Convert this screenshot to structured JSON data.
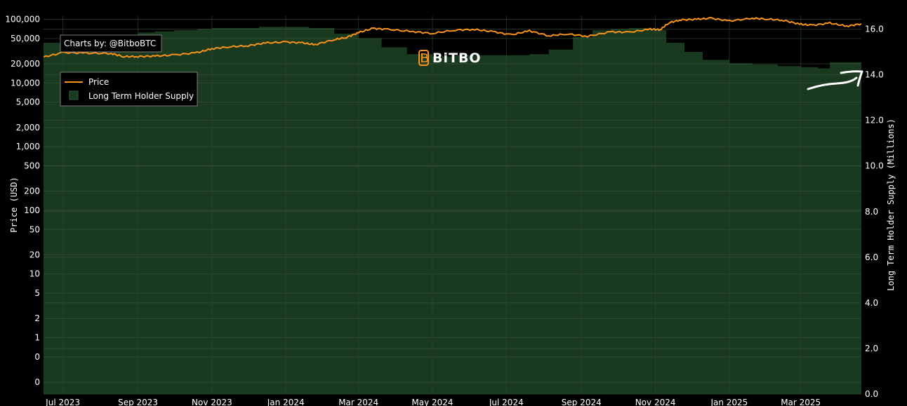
{
  "chart_data": {
    "type": "area",
    "credit": "Charts by: @BitboBTC",
    "logo": "BiTBO",
    "x_tick_labels": [
      "Jul 2023",
      "Sep 2023",
      "Nov 2023",
      "Jan 2024",
      "Mar 2024",
      "May 2024",
      "Jul 2024",
      "Sep 2024",
      "Nov 2024",
      "Jan 2025",
      "Mar 2025"
    ],
    "x_tick_dates": [
      "2023-07-01",
      "2023-09-01",
      "2023-11-01",
      "2024-01-01",
      "2024-03-01",
      "2024-05-01",
      "2024-07-01",
      "2024-09-01",
      "2024-11-01",
      "2025-01-01",
      "2025-03-01"
    ],
    "x_range": [
      "2023-06-15",
      "2025-04-20"
    ],
    "y_left": {
      "title": "Price (USD)",
      "scale": "log",
      "tick_labels": [
        "100,000",
        "50,000",
        "20,000",
        "10,000",
        "5,000",
        "2,000",
        "1,000",
        "500",
        "200",
        "100",
        "50",
        "20",
        "10",
        "5",
        "2",
        "1",
        "0",
        "0"
      ],
      "tick_values": [
        100000,
        50000,
        20000,
        10000,
        5000,
        2000,
        1000,
        500,
        200,
        100,
        50,
        20,
        10,
        5,
        2,
        1,
        0.5,
        0.2
      ],
      "range": [
        0.13,
        115000
      ]
    },
    "y_right": {
      "title": "Long Term Holder Supply (Millions)",
      "scale": "linear",
      "tick_labels": [
        "16.0",
        "14.0",
        "12.0",
        "10.0",
        "8.0",
        "6.0",
        "4.0",
        "2.0",
        "0.0"
      ],
      "tick_values": [
        16,
        14,
        12,
        10,
        8,
        6,
        4,
        2,
        0
      ],
      "range": [
        0,
        16.6
      ]
    },
    "grid": true,
    "legend": {
      "placement": "top-left",
      "items": [
        {
          "label": "Price",
          "color": "#f7931a"
        },
        {
          "label": "Long Term Holder Supply",
          "color": "#1a3a1f"
        }
      ]
    },
    "series": [
      {
        "name": "Price",
        "color": "#f7931a",
        "axis": "left",
        "x": [
          "2023-06-15",
          "2023-07-01",
          "2023-07-20",
          "2023-08-10",
          "2023-08-20",
          "2023-09-01",
          "2023-09-15",
          "2023-10-01",
          "2023-10-20",
          "2023-11-01",
          "2023-11-15",
          "2023-12-01",
          "2023-12-15",
          "2024-01-01",
          "2024-01-15",
          "2024-01-25",
          "2024-02-10",
          "2024-02-20",
          "2024-03-01",
          "2024-03-13",
          "2024-03-25",
          "2024-04-15",
          "2024-05-01",
          "2024-05-20",
          "2024-06-05",
          "2024-06-20",
          "2024-07-05",
          "2024-07-20",
          "2024-08-05",
          "2024-08-20",
          "2024-09-06",
          "2024-09-25",
          "2024-10-10",
          "2024-10-28",
          "2024-11-05",
          "2024-11-12",
          "2024-11-22",
          "2024-12-05",
          "2024-12-17",
          "2025-01-01",
          "2025-01-20",
          "2025-02-01",
          "2025-02-15",
          "2025-02-28",
          "2025-03-10",
          "2025-03-25",
          "2025-04-08",
          "2025-04-20"
        ],
        "y": [
          25500,
          30000,
          29500,
          29000,
          26000,
          26000,
          26500,
          27500,
          30000,
          34500,
          37000,
          38500,
          42500,
          44000,
          42500,
          40000,
          48000,
          52000,
          62000,
          72000,
          69500,
          64000,
          60000,
          68000,
          69000,
          64000,
          57000,
          66000,
          55000,
          59000,
          54000,
          63500,
          62500,
          70000,
          68500,
          88000,
          98000,
          100000,
          104000,
          94000,
          104000,
          101000,
          96000,
          84000,
          80500,
          87000,
          78000,
          85000
        ]
      },
      {
        "name": "Long Term Holder Supply",
        "color": "#1a3a1f",
        "axis": "right",
        "x": [
          "2023-06-15",
          "2023-07-01",
          "2023-07-20",
          "2023-08-10",
          "2023-09-01",
          "2023-09-15",
          "2023-10-01",
          "2023-10-20",
          "2023-11-01",
          "2023-11-20",
          "2023-12-10",
          "2024-01-01",
          "2024-01-20",
          "2024-02-10",
          "2024-03-01",
          "2024-03-20",
          "2024-04-10",
          "2024-05-01",
          "2024-05-20",
          "2024-06-10",
          "2024-07-01",
          "2024-07-20",
          "2024-08-05",
          "2024-08-25",
          "2024-09-10",
          "2024-09-25",
          "2024-10-10",
          "2024-10-28",
          "2024-11-10",
          "2024-11-25",
          "2024-12-10",
          "2025-01-01",
          "2025-01-20",
          "2025-02-10",
          "2025-03-01",
          "2025-03-15",
          "2025-03-25",
          "2025-04-20"
        ],
        "y": [
          15.4,
          15.45,
          15.6,
          15.75,
          15.85,
          15.9,
          15.95,
          16.0,
          16.05,
          16.05,
          16.1,
          16.1,
          16.05,
          15.8,
          15.6,
          15.2,
          14.9,
          14.8,
          14.85,
          14.85,
          14.85,
          14.9,
          15.1,
          15.65,
          15.95,
          16.0,
          16.05,
          15.95,
          15.4,
          15.0,
          14.65,
          14.5,
          14.45,
          14.38,
          14.33,
          14.28,
          14.55,
          14.6
        ]
      }
    ]
  }
}
